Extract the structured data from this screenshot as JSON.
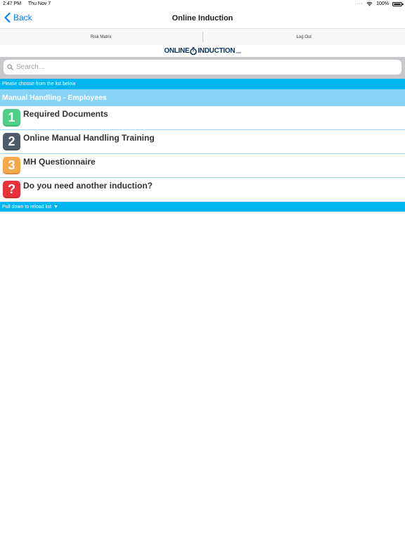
{
  "status_bar": {
    "time": "2:47 PM",
    "date": "Thu Nov 7",
    "battery": "100%"
  },
  "nav": {
    "back_label": "Back",
    "title": "Online Induction"
  },
  "tabs": {
    "risk_matrix": "Risk Matrix",
    "log_out": "Log Out"
  },
  "logo": {
    "text_left": "ONLINE",
    "text_right": "INDUCTION",
    "text_suffix": ".com"
  },
  "search": {
    "placeholder": "Search..."
  },
  "info_text": "Please choose from the list below",
  "section_title": "Manual Handling - Employees",
  "items": [
    {
      "badge": "1",
      "label": "Required Documents",
      "color": "#4fcf86"
    },
    {
      "badge": "2",
      "label": "Online Manual Handling Training",
      "color": "#4f5a6b"
    },
    {
      "badge": "3",
      "label": "MH Questionnaire",
      "color": "#f7a84a"
    },
    {
      "badge": "?",
      "label": "Do you need another induction?",
      "color": "#e8313a"
    }
  ],
  "footer": {
    "text": "Pull down to reload list",
    "arrow": "▼"
  }
}
